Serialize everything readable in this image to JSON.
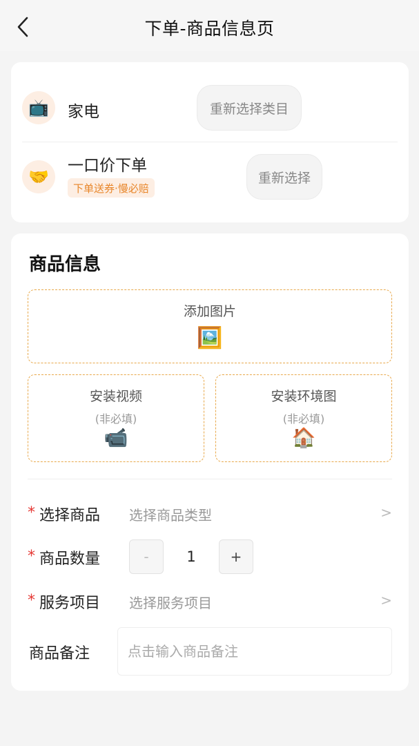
{
  "header": {
    "title": "下单-商品信息页"
  },
  "category": {
    "rows": [
      {
        "icon": "📺",
        "label": "家电",
        "button": "重新选择类目"
      },
      {
        "icon": "🤝",
        "label": "一口价下单",
        "tag": "下单送券·慢必赔",
        "button": "重新选择"
      }
    ]
  },
  "product_info": {
    "title": "商品信息",
    "upload_main": {
      "label": "添加图片",
      "icon": "🖼️"
    },
    "upload_video": {
      "label": "安装视频",
      "sub": "(非必填)",
      "icon": "📹"
    },
    "upload_env": {
      "label": "安装环境图",
      "sub": "(非必填)",
      "icon": "🏠"
    },
    "form": {
      "product": {
        "required": "*",
        "label": "选择商品",
        "placeholder": "选择商品类型",
        "arrow": ">"
      },
      "quantity": {
        "required": "*",
        "label": "商品数量",
        "minus": "-",
        "value": "1",
        "plus": "+"
      },
      "service": {
        "required": "*",
        "label": "服务项目",
        "placeholder": "选择服务项目",
        "arrow": ">"
      },
      "note": {
        "label": "商品备注",
        "placeholder": "点击输入商品备注"
      }
    }
  }
}
